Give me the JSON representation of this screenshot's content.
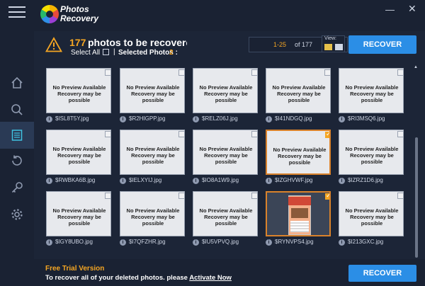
{
  "app": {
    "logo_line1": "Photos",
    "logo_line2": "Recovery"
  },
  "window": {
    "minimize_glyph": "—",
    "close_glyph": "✕"
  },
  "sidebar": {
    "items": [
      {
        "icon": "home-icon",
        "active": false
      },
      {
        "icon": "search-icon",
        "active": false
      },
      {
        "icon": "list-icon",
        "active": true
      },
      {
        "icon": "history-icon",
        "active": false
      },
      {
        "icon": "key-icon",
        "active": false
      },
      {
        "icon": "gear-icon",
        "active": false
      }
    ]
  },
  "header": {
    "count": "177",
    "title_rest": "photos to be recoverec",
    "select_all_label": "Select All",
    "separator": "|",
    "selected_label": "Selected Photos :",
    "selected_count": "2",
    "pager_range": "1-25",
    "pager_of": "of 177",
    "pager_prev": "◀",
    "pager_next": "▶",
    "view_label": "View:",
    "recover_label": "RECOVER"
  },
  "photos": [
    {
      "name": "$ISL8T5Y.jpg",
      "no_preview_1": "No Preview Available",
      "no_preview_2": "Recovery may be possible",
      "checked": false,
      "preview": false
    },
    {
      "name": "$R2HIGPP.jpg",
      "no_preview_1": "No Preview Available",
      "no_preview_2": "Recovery may be possible",
      "checked": false,
      "preview": false
    },
    {
      "name": "$RELZ06J.jpg",
      "no_preview_1": "No Preview Available",
      "no_preview_2": "Recovery may be possible",
      "checked": false,
      "preview": false
    },
    {
      "name": "$I41NDGQ.jpg",
      "no_preview_1": "No Preview Available",
      "no_preview_2": "Recovery may be possible",
      "checked": false,
      "preview": false
    },
    {
      "name": "$RI3MSQ6.jpg",
      "no_preview_1": "No Preview Available",
      "no_preview_2": "Recovery may be possible",
      "checked": false,
      "preview": false
    },
    {
      "name": "$RWBKA6B.jpg",
      "no_preview_1": "No Preview Available",
      "no_preview_2": "Recovery may be possible",
      "checked": false,
      "preview": false
    },
    {
      "name": "$IELXYIJ.jpg",
      "no_preview_1": "No Preview Available",
      "no_preview_2": "Recovery may be possible",
      "checked": false,
      "preview": false
    },
    {
      "name": "$IO8A1W9.jpg",
      "no_preview_1": "No Preview Available",
      "no_preview_2": "Recovery may be possible",
      "checked": false,
      "preview": false
    },
    {
      "name": "$IZGHVWF.jpg",
      "no_preview_1": "No Preview Available",
      "no_preview_2": "Recovery may be possible",
      "checked": true,
      "preview": false
    },
    {
      "name": "$IZRZ1D6.jpg",
      "no_preview_1": "No Preview Available",
      "no_preview_2": "Recovery may be possible",
      "checked": false,
      "preview": false
    },
    {
      "name": "$IGY8UBO.jpg",
      "no_preview_1": "No Preview Available",
      "no_preview_2": "Recovery may be possible",
      "checked": false,
      "preview": false
    },
    {
      "name": "$I7QFZHR.jpg",
      "no_preview_1": "No Preview Available",
      "no_preview_2": "Recovery may be possible",
      "checked": false,
      "preview": false
    },
    {
      "name": "$IU5VPVQ.jpg",
      "no_preview_1": "No Preview Available",
      "no_preview_2": "Recovery may be possible",
      "checked": false,
      "preview": false
    },
    {
      "name": "$RYNVPS4.jpg",
      "no_preview_1": "",
      "no_preview_2": "",
      "checked": true,
      "preview": true
    },
    {
      "name": "$I213GXC.jpg",
      "no_preview_1": "No Preview Available",
      "no_preview_2": "Recovery may be possible",
      "checked": false,
      "preview": false
    }
  ],
  "footer": {
    "trial_label": "Free Trial Version",
    "message": "To recover all of your deleted photos. please",
    "activate_link": "Activate Now",
    "recover_label": "RECOVER"
  },
  "colors": {
    "accent_orange": "#f5a623",
    "button_blue": "#2b8ee6",
    "background": "#1c2537",
    "sidebar": "#1a2233"
  }
}
